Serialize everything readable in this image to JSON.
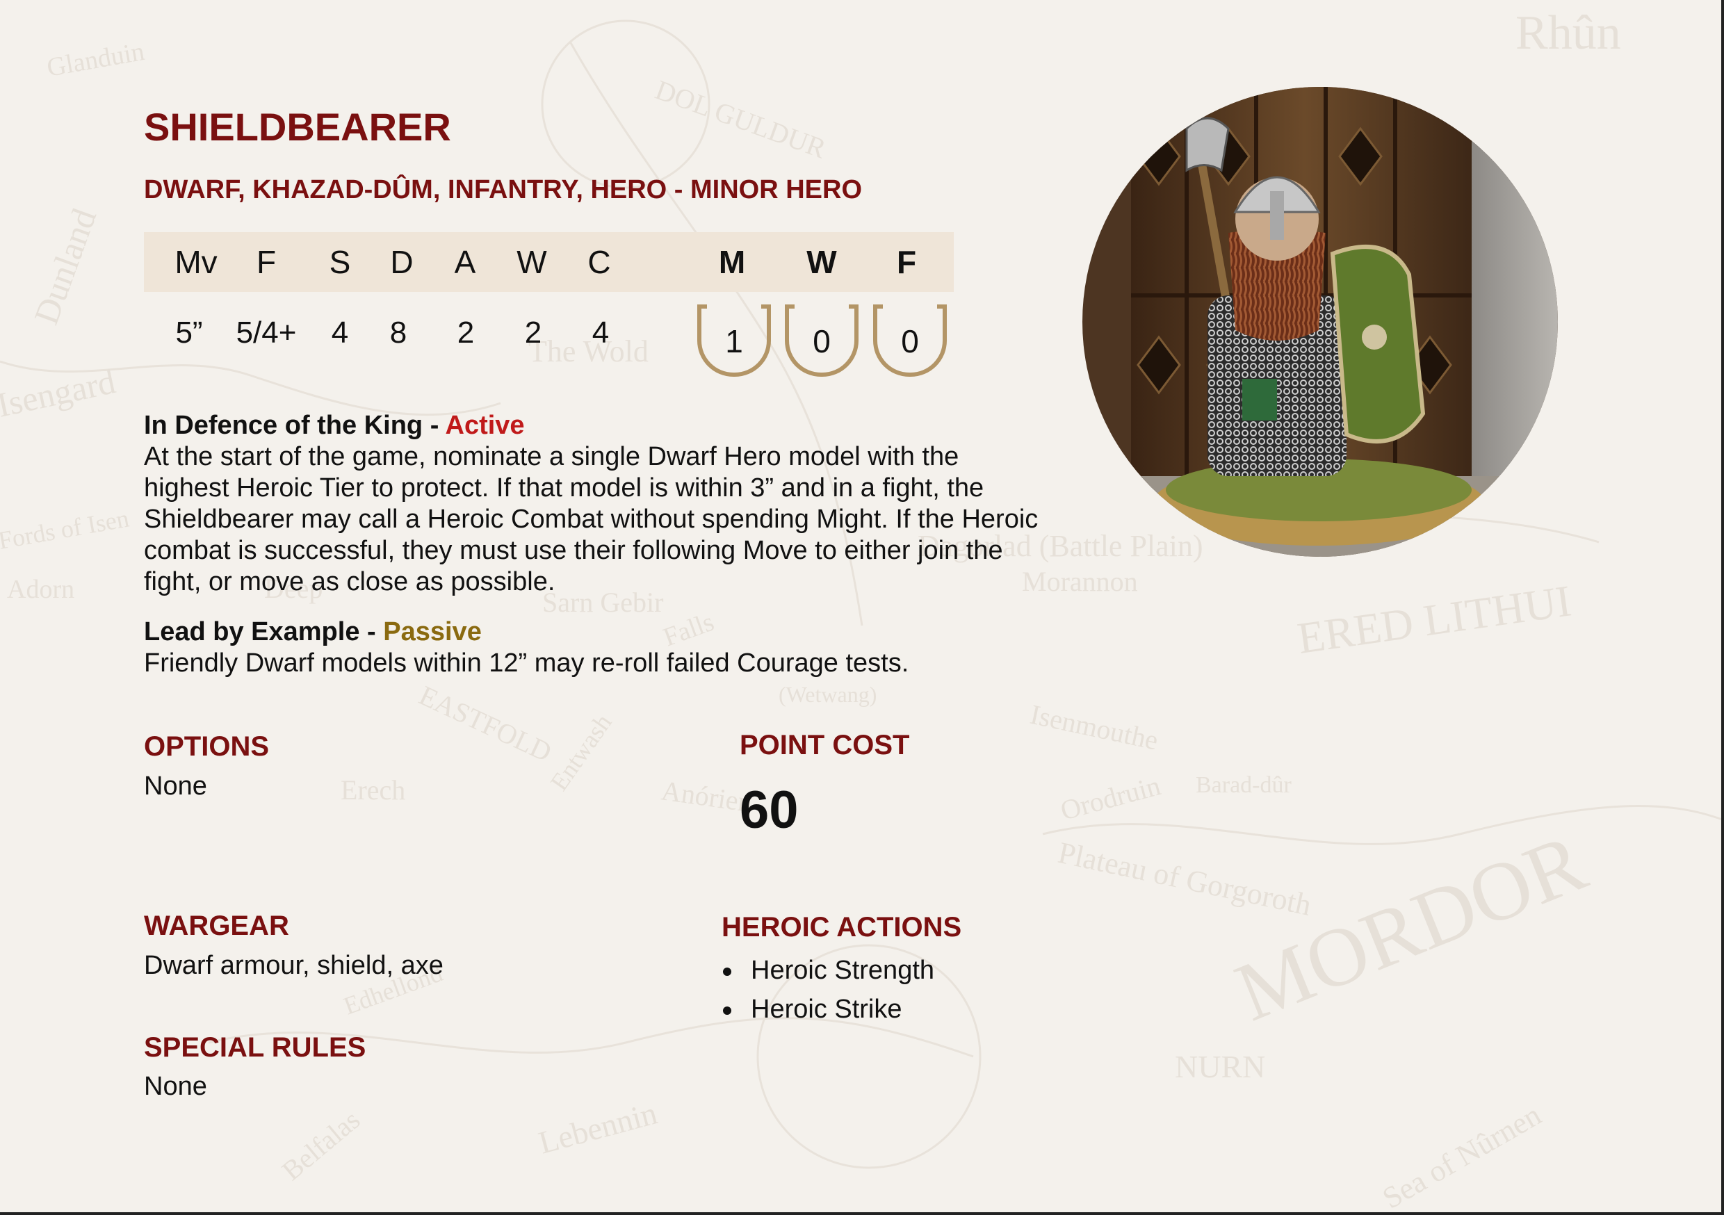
{
  "card": {
    "title": "SHIELDBEARER",
    "keywords": "DWARF, KHAZAD-DÛM, INFANTRY, HERO - MINOR HERO"
  },
  "stats": {
    "headers": [
      "Mv",
      "F",
      "S",
      "D",
      "A",
      "W",
      "C"
    ],
    "values": [
      "5”",
      "5/4+",
      "4",
      "8",
      "2",
      "2",
      "4"
    ],
    "heroic_headers": [
      "M",
      "W",
      "F"
    ],
    "heroic_values": [
      "1",
      "0",
      "0"
    ]
  },
  "rules": [
    {
      "name": "In Defence of the King",
      "separator": " - ",
      "type": "Active",
      "text": "At the start of the game, nominate a single Dwarf Hero model with the highest Heroic Tier to protect. If that model is within 3” and in a fight, the Shieldbearer may call a Heroic Combat without spending Might. If the Heroic combat is successful, they must use their following Move to either join the fight, or move as close as possible."
    },
    {
      "name": "Lead by Example",
      "separator": " - ",
      "type": "Passive",
      "text": "Friendly Dwarf models within 12” may re-roll failed Courage tests."
    }
  ],
  "options": {
    "heading": "OPTIONS",
    "value": "None"
  },
  "point_cost": {
    "heading": "POINT COST",
    "value": "60"
  },
  "wargear": {
    "heading": "WARGEAR",
    "value": "Dwarf armour, shield, axe"
  },
  "heroic_actions": {
    "heading": "HEROIC ACTIONS",
    "items": [
      "Heroic Strength",
      "Heroic Strike"
    ]
  },
  "special_rules": {
    "heading": "SPECIAL RULES",
    "value": "None"
  },
  "map_labels": {
    "rhun": "Rhûn",
    "mordor": "MORDOR",
    "ered_lithui": "ERED LITHUI",
    "isengard": "Isengard",
    "dol_guldur": "DOL GULDUR",
    "the_wold": "The Wold",
    "dagorlad": "Dagorlad (Battle Plain)",
    "gorgoroth": "Plateau of Gorgoroth",
    "nurn": "NURN",
    "sea_of_nurnen": "Sea of Nûrnen",
    "morannon": "Morannon",
    "barad_dur": "Barad-dûr",
    "orodruin": "Orodruin",
    "sarn_gebir": "Sarn Gebir",
    "falls_of_rauros": "Falls",
    "erech": "Erech",
    "anorien": "Anórien",
    "lebennin": "Lebennin",
    "dunland": "Dunland",
    "glanduin": "Glanduin",
    "adorn": "Adorn",
    "deep": "Deep",
    "belfalas": "Belfalas",
    "edhellond": "Edhellond",
    "isenmouthe": "Isenmouthe",
    "wetwang": "(Wetwang)",
    "fords_of_isen": "Fords of Isen",
    "entwash": "Entwash",
    "eastfold": "EASTFOLD"
  }
}
